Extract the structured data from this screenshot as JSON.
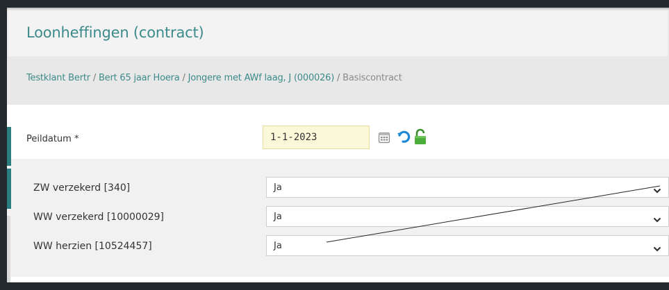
{
  "window": {
    "title": "Loonheffingen (contract)"
  },
  "breadcrumb": {
    "client": "Testklant Bertr",
    "employee": "Bert 65 jaar Hoera",
    "group": "Jongere met AWf laag, J (000026)",
    "contract": "Basiscontract",
    "separator": " / "
  },
  "peildatum": {
    "label": "Peildatum *",
    "value": "1-1-2023",
    "icons": [
      "calendar-icon",
      "reset-icon",
      "unlock-icon"
    ]
  },
  "fields": [
    {
      "label": "ZW verzekerd [340]",
      "value": "Ja"
    },
    {
      "label": "WW verzekerd [10000029]",
      "value": "Ja"
    },
    {
      "label": "WW herzien [10524457]",
      "value": "Ja"
    }
  ],
  "colors": {
    "accent": "#2a7d7f",
    "title_text": "#3d8a8a",
    "date_bg": "#fbf7d9",
    "lock_green": "#4caf3b",
    "reset_blue": "#1e88d6"
  }
}
